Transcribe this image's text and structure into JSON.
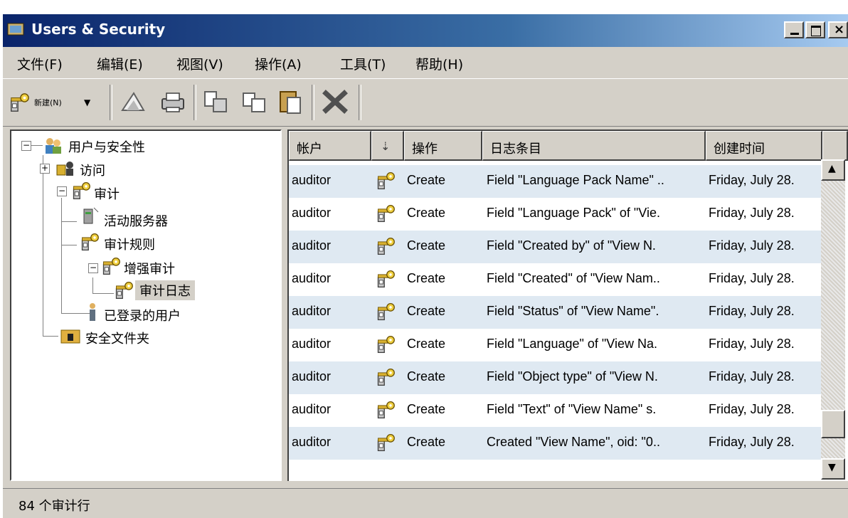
{
  "window": {
    "title": "Users & Security",
    "minimize_icon": "minimize-icon",
    "maximize_icon": "maximize-icon",
    "close_icon": "close-icon"
  },
  "menu": {
    "items": [
      {
        "label": "文件(F)"
      },
      {
        "label": "编辑(E)"
      },
      {
        "label": "视图(V)"
      },
      {
        "label": "操作(A)"
      },
      {
        "label": "工具(T)"
      },
      {
        "label": "帮助(H)"
      }
    ]
  },
  "toolbar": {
    "new_label": "新建(N)",
    "icons": [
      "audit-key-icon",
      "properties-icon",
      "print-icon",
      "cut-icon",
      "copy-icon",
      "paste-icon",
      "delete-icon"
    ]
  },
  "tree": {
    "nodes": [
      {
        "label": "用户与安全性",
        "icon": "users-security-icon"
      },
      {
        "label": "访问",
        "icon": "access-icon"
      },
      {
        "label": "审计",
        "icon": "audit-key-icon"
      },
      {
        "label": "活动服务器",
        "icon": "server-icon"
      },
      {
        "label": "审计规则",
        "icon": "audit-key-icon"
      },
      {
        "label": "增强审计",
        "icon": "audit-key-icon"
      },
      {
        "label": "审计日志",
        "icon": "audit-key-icon"
      },
      {
        "label": "已登录的用户",
        "icon": "user-icon"
      },
      {
        "label": "安全文件夹",
        "icon": "secure-folder-icon"
      }
    ]
  },
  "list": {
    "columns": [
      {
        "label": "帐户"
      },
      {
        "label": ""
      },
      {
        "label": "操作"
      },
      {
        "label": "日志条目"
      },
      {
        "label": "创建时间"
      }
    ],
    "rows": [
      {
        "account": "auditor",
        "action": "Create",
        "entry": "Field \"Language Pack Name\" ..",
        "created": "Friday, July 28."
      },
      {
        "account": "auditor",
        "action": "Create",
        "entry": "Field \"Language Pack\" of \"Vie.",
        "created": "Friday, July 28."
      },
      {
        "account": "auditor",
        "action": "Create",
        "entry": "Field \"Created by\" of \"View N.",
        "created": "Friday, July 28."
      },
      {
        "account": "auditor",
        "action": "Create",
        "entry": "Field \"Created\" of \"View Nam..",
        "created": "Friday, July 28."
      },
      {
        "account": "auditor",
        "action": "Create",
        "entry": "Field \"Status\" of \"View Name\".",
        "created": "Friday, July 28."
      },
      {
        "account": "auditor",
        "action": "Create",
        "entry": "Field \"Language\" of \"View Na.",
        "created": "Friday, July 28."
      },
      {
        "account": "auditor",
        "action": "Create",
        "entry": "Field \"Object type\" of \"View N.",
        "created": "Friday, July 28."
      },
      {
        "account": "auditor",
        "action": "Create",
        "entry": "Field \"Text\" of \"View Name\" s.",
        "created": "Friday, July 28."
      },
      {
        "account": "auditor",
        "action": "Create",
        "entry": "Created \"View Name\", oid: \"0..",
        "created": "Friday, July 28."
      }
    ]
  },
  "status": {
    "text": "84 个审计行"
  }
}
